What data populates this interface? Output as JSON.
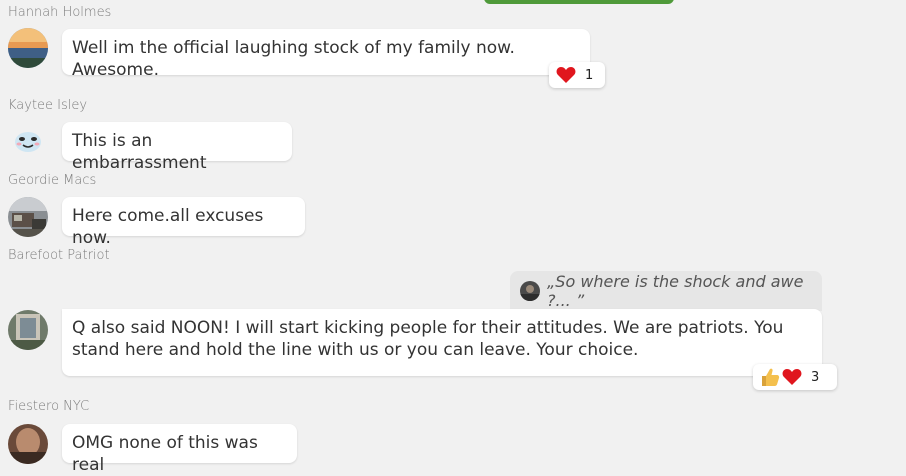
{
  "messages": [
    {
      "author": "Hannah Holmes",
      "text": "Well im the official laughing stock of my family now. Awesome.",
      "reaction_count": "1"
    },
    {
      "author": "Kaytee Isley",
      "text": "This is an embarrassment"
    },
    {
      "author": "Geordie Macs",
      "text": "Here come.all excuses now."
    },
    {
      "author": "Barefoot Patriot",
      "quote": "„So where is the shock and awe ?... ”",
      "text": "Q also said NOON! I will start kicking people for their attitudes. We are patriots. You stand here and hold the line with us or you can leave. Your choice.",
      "reaction_count": "3"
    },
    {
      "author": "Fiestero NYC",
      "text": "OMG none of this was real"
    }
  ],
  "colors": {
    "accent": "#4f9a3a",
    "heart": "#e0161e",
    "background": "#f1f1f1"
  },
  "icons": [
    "heart-icon",
    "thumbs-up-icon"
  ]
}
